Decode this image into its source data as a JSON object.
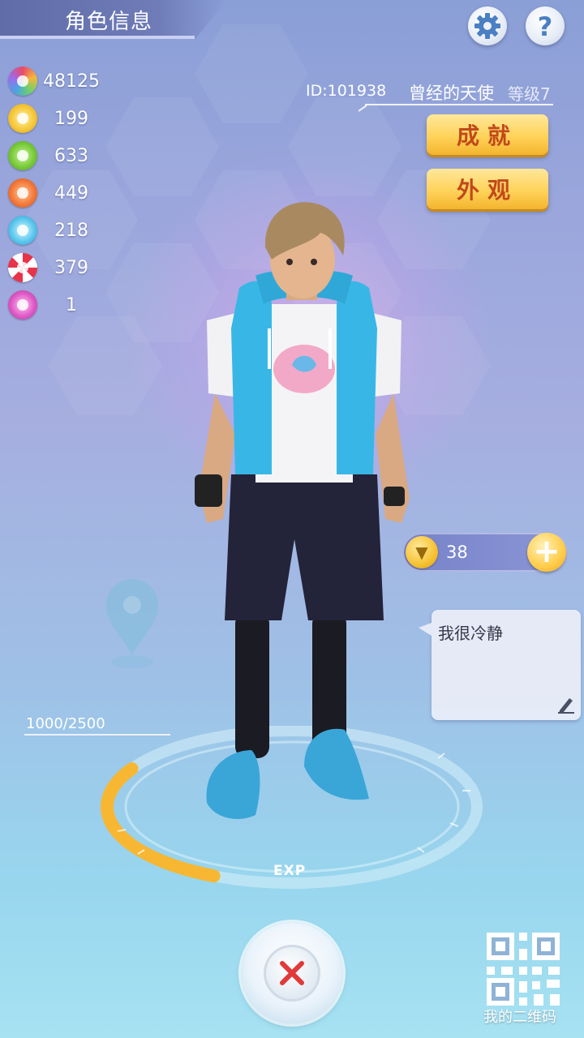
{
  "header": {
    "title": "角色信息"
  },
  "currencies": [
    {
      "icon": "star-gem-icon",
      "value": "48125"
    },
    {
      "icon": "yellow-donut-icon",
      "value": "199"
    },
    {
      "icon": "green-donut-icon",
      "value": "633"
    },
    {
      "icon": "orange-donut-icon",
      "value": "449"
    },
    {
      "icon": "blue-donut-icon",
      "value": "218"
    },
    {
      "icon": "red-candy-icon",
      "value": "379"
    },
    {
      "icon": "pink-donut-icon",
      "value": "1"
    }
  ],
  "profile": {
    "id": "ID:101938",
    "nickname": "曾经的天使",
    "level": "等级7"
  },
  "buttons": {
    "achievements": "成就",
    "appearance": "外观"
  },
  "coins": {
    "value": "38"
  },
  "status_message": "我很冷静",
  "exp": {
    "text": "1000/2500",
    "label": "EXP",
    "fraction": 0.4
  },
  "qr": {
    "label": "我的二维码"
  },
  "colors": {
    "gold": "#ffd35a",
    "button_text": "#c2491a",
    "exp_bar": "#f7b733"
  }
}
